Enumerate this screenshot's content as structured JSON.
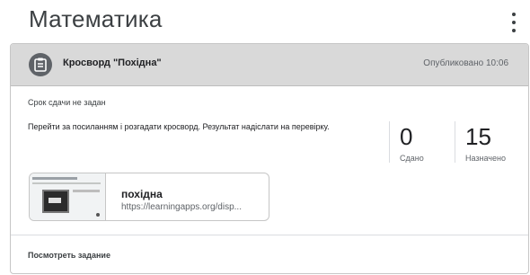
{
  "course": {
    "title": "Математика"
  },
  "assignment": {
    "title": "Кросворд \"Похідна\"",
    "published": "Опубликовано 10:06",
    "due": "Срок сдачи не задан",
    "description": "Перейти за посиланням і розгадати кросворд. Результат надіслати на перевірку.",
    "stats": [
      {
        "value": "0",
        "label": "Сдано"
      },
      {
        "value": "15",
        "label": "Назначено"
      }
    ],
    "attachment": {
      "title": "похідна",
      "url": "https://learningapps.org/disp..."
    },
    "view_label": "Посмотреть задание"
  },
  "icons": {
    "menu": "more-vert-icon",
    "assignment": "assignment-icon"
  },
  "colors": {
    "header_bg": "#d9d9d9",
    "icon_bg": "#5f6368"
  }
}
